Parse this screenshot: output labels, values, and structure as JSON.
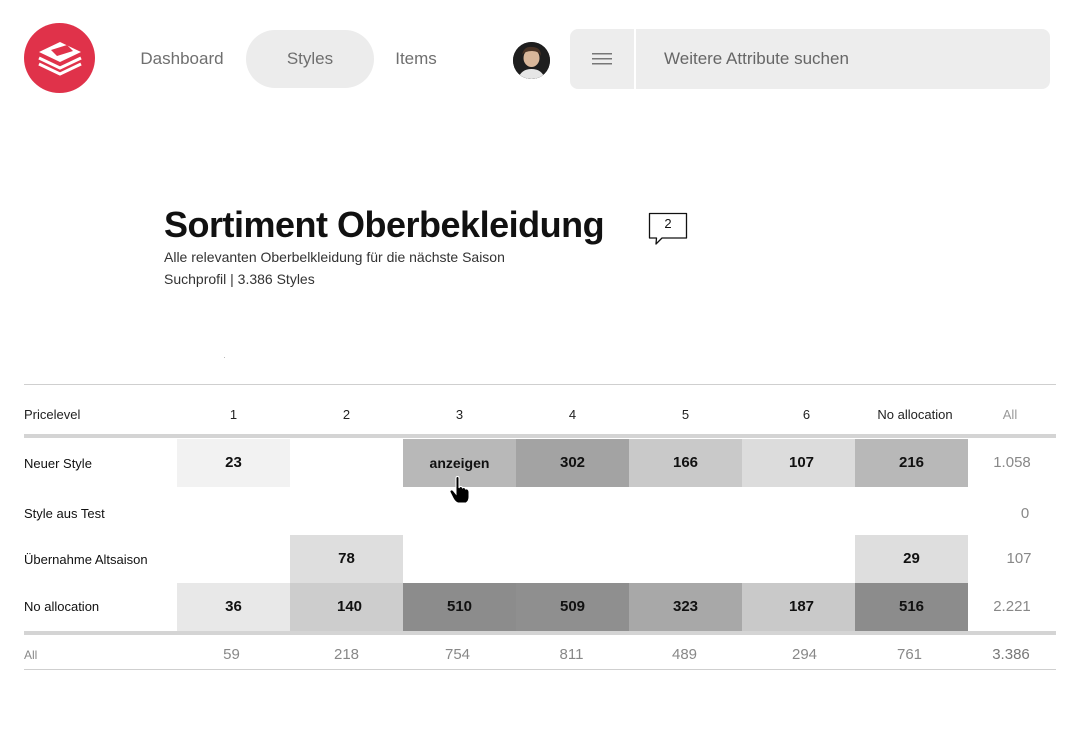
{
  "nav": {
    "dashboard": "Dashboard",
    "styles": "Styles",
    "items": "Items"
  },
  "search": {
    "placeholder": "Weitere Attribute suchen"
  },
  "page": {
    "title": "Sortiment Oberbekleidung",
    "comment_count": "2",
    "subtitle": "Alle relevanten Oberbelkleidung für die nächste Saison",
    "meta": "Suchprofil | 3.386 Styles"
  },
  "table": {
    "header_label": "Pricelevel",
    "columns": [
      "1",
      "2",
      "3",
      "4",
      "5",
      "6",
      "No allocation"
    ],
    "total_label": "All",
    "rows": [
      {
        "label": "Neuer Style",
        "cells": [
          "23",
          "",
          "anzeigen",
          "302",
          "166",
          "107",
          "216"
        ],
        "total": "1.058"
      },
      {
        "label": "Style aus Test",
        "cells": [
          "",
          "",
          "",
          "",
          "",
          "",
          ""
        ],
        "total": "0"
      },
      {
        "label": "Übernahme Altsaison",
        "cells": [
          "",
          "78",
          "",
          "",
          "",
          "",
          "29"
        ],
        "total": "107"
      },
      {
        "label": "No allocation",
        "cells": [
          "36",
          "140",
          "510",
          "509",
          "323",
          "187",
          "516"
        ],
        "total": "2.221"
      }
    ],
    "footer": {
      "label": "All",
      "values": [
        "59",
        "218",
        "754",
        "811",
        "489",
        "294",
        "761"
      ],
      "total": "3.386"
    }
  },
  "colors": {
    "brand": "#e0324a",
    "heat": {
      "r0": [
        "#f2f2f2",
        "",
        "#b8b8b8",
        "#a3a3a3",
        "#c9c9c9",
        "#dcdcdc",
        "#b8b8b8"
      ],
      "r2": [
        "",
        "#dedede",
        "",
        "",
        "",
        "",
        "#dedede"
      ],
      "r3": [
        "#e8e8e8",
        "#cdcdcd",
        "#8c8c8c",
        "#8f8f8f",
        "#a8a8a8",
        "#c9c9c9",
        "#8c8c8c"
      ]
    }
  },
  "icons": {
    "logo": "layers-logo-icon",
    "menu": "hamburger-menu-icon",
    "comment": "comment-bubble-icon",
    "cursor": "hand-pointer-icon"
  }
}
